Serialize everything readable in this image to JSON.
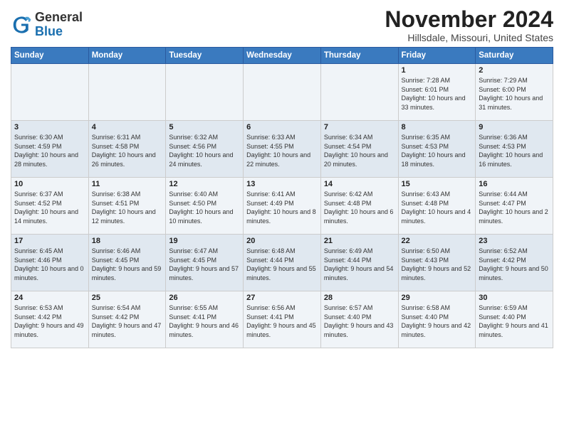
{
  "logo": {
    "general": "General",
    "blue": "Blue"
  },
  "title": "November 2024",
  "location": "Hillsdale, Missouri, United States",
  "headers": [
    "Sunday",
    "Monday",
    "Tuesday",
    "Wednesday",
    "Thursday",
    "Friday",
    "Saturday"
  ],
  "weeks": [
    [
      {
        "day": "",
        "info": ""
      },
      {
        "day": "",
        "info": ""
      },
      {
        "day": "",
        "info": ""
      },
      {
        "day": "",
        "info": ""
      },
      {
        "day": "",
        "info": ""
      },
      {
        "day": "1",
        "info": "Sunrise: 7:28 AM\nSunset: 6:01 PM\nDaylight: 10 hours and 33 minutes."
      },
      {
        "day": "2",
        "info": "Sunrise: 7:29 AM\nSunset: 6:00 PM\nDaylight: 10 hours and 31 minutes."
      }
    ],
    [
      {
        "day": "3",
        "info": "Sunrise: 6:30 AM\nSunset: 4:59 PM\nDaylight: 10 hours and 28 minutes."
      },
      {
        "day": "4",
        "info": "Sunrise: 6:31 AM\nSunset: 4:58 PM\nDaylight: 10 hours and 26 minutes."
      },
      {
        "day": "5",
        "info": "Sunrise: 6:32 AM\nSunset: 4:56 PM\nDaylight: 10 hours and 24 minutes."
      },
      {
        "day": "6",
        "info": "Sunrise: 6:33 AM\nSunset: 4:55 PM\nDaylight: 10 hours and 22 minutes."
      },
      {
        "day": "7",
        "info": "Sunrise: 6:34 AM\nSunset: 4:54 PM\nDaylight: 10 hours and 20 minutes."
      },
      {
        "day": "8",
        "info": "Sunrise: 6:35 AM\nSunset: 4:53 PM\nDaylight: 10 hours and 18 minutes."
      },
      {
        "day": "9",
        "info": "Sunrise: 6:36 AM\nSunset: 4:53 PM\nDaylight: 10 hours and 16 minutes."
      }
    ],
    [
      {
        "day": "10",
        "info": "Sunrise: 6:37 AM\nSunset: 4:52 PM\nDaylight: 10 hours and 14 minutes."
      },
      {
        "day": "11",
        "info": "Sunrise: 6:38 AM\nSunset: 4:51 PM\nDaylight: 10 hours and 12 minutes."
      },
      {
        "day": "12",
        "info": "Sunrise: 6:40 AM\nSunset: 4:50 PM\nDaylight: 10 hours and 10 minutes."
      },
      {
        "day": "13",
        "info": "Sunrise: 6:41 AM\nSunset: 4:49 PM\nDaylight: 10 hours and 8 minutes."
      },
      {
        "day": "14",
        "info": "Sunrise: 6:42 AM\nSunset: 4:48 PM\nDaylight: 10 hours and 6 minutes."
      },
      {
        "day": "15",
        "info": "Sunrise: 6:43 AM\nSunset: 4:48 PM\nDaylight: 10 hours and 4 minutes."
      },
      {
        "day": "16",
        "info": "Sunrise: 6:44 AM\nSunset: 4:47 PM\nDaylight: 10 hours and 2 minutes."
      }
    ],
    [
      {
        "day": "17",
        "info": "Sunrise: 6:45 AM\nSunset: 4:46 PM\nDaylight: 10 hours and 0 minutes."
      },
      {
        "day": "18",
        "info": "Sunrise: 6:46 AM\nSunset: 4:45 PM\nDaylight: 9 hours and 59 minutes."
      },
      {
        "day": "19",
        "info": "Sunrise: 6:47 AM\nSunset: 4:45 PM\nDaylight: 9 hours and 57 minutes."
      },
      {
        "day": "20",
        "info": "Sunrise: 6:48 AM\nSunset: 4:44 PM\nDaylight: 9 hours and 55 minutes."
      },
      {
        "day": "21",
        "info": "Sunrise: 6:49 AM\nSunset: 4:44 PM\nDaylight: 9 hours and 54 minutes."
      },
      {
        "day": "22",
        "info": "Sunrise: 6:50 AM\nSunset: 4:43 PM\nDaylight: 9 hours and 52 minutes."
      },
      {
        "day": "23",
        "info": "Sunrise: 6:52 AM\nSunset: 4:42 PM\nDaylight: 9 hours and 50 minutes."
      }
    ],
    [
      {
        "day": "24",
        "info": "Sunrise: 6:53 AM\nSunset: 4:42 PM\nDaylight: 9 hours and 49 minutes."
      },
      {
        "day": "25",
        "info": "Sunrise: 6:54 AM\nSunset: 4:42 PM\nDaylight: 9 hours and 47 minutes."
      },
      {
        "day": "26",
        "info": "Sunrise: 6:55 AM\nSunset: 4:41 PM\nDaylight: 9 hours and 46 minutes."
      },
      {
        "day": "27",
        "info": "Sunrise: 6:56 AM\nSunset: 4:41 PM\nDaylight: 9 hours and 45 minutes."
      },
      {
        "day": "28",
        "info": "Sunrise: 6:57 AM\nSunset: 4:40 PM\nDaylight: 9 hours and 43 minutes."
      },
      {
        "day": "29",
        "info": "Sunrise: 6:58 AM\nSunset: 4:40 PM\nDaylight: 9 hours and 42 minutes."
      },
      {
        "day": "30",
        "info": "Sunrise: 6:59 AM\nSunset: 4:40 PM\nDaylight: 9 hours and 41 minutes."
      }
    ]
  ]
}
